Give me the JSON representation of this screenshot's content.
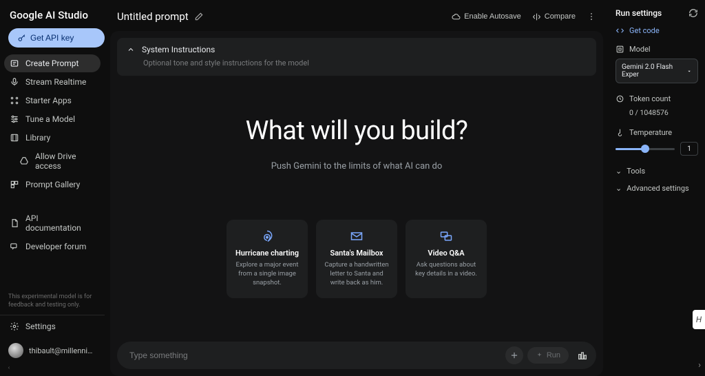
{
  "app": {
    "name": "Google AI Studio"
  },
  "sidebar": {
    "api_button": "Get API key",
    "nav": [
      {
        "label": "Create Prompt"
      },
      {
        "label": "Stream Realtime"
      },
      {
        "label": "Starter Apps"
      },
      {
        "label": "Tune a Model"
      },
      {
        "label": "Library"
      },
      {
        "label": "Allow Drive access"
      },
      {
        "label": "Prompt Gallery"
      }
    ],
    "nav2": [
      {
        "label": "API documentation"
      },
      {
        "label": "Developer forum"
      }
    ],
    "disclaimer": "This experimental model is for feedback and testing only.",
    "settings": "Settings",
    "user": "thibault@millennium-dig..."
  },
  "topbar": {
    "title": "Untitled prompt",
    "autosave": "Enable Autosave",
    "compare": "Compare"
  },
  "system_instructions": {
    "title": "System Instructions",
    "subtitle": "Optional tone and style instructions for the model"
  },
  "hero": {
    "heading": "What will you build?",
    "sub": "Push Gemini to the limits of what AI can do"
  },
  "cards": [
    {
      "title": "Hurricane charting",
      "desc": "Explore a major event from a single image snapshot."
    },
    {
      "title": "Santa's Mailbox",
      "desc": "Capture a handwritten letter to Santa and write back as him."
    },
    {
      "title": "Video Q&A",
      "desc": "Ask questions about key details in a video."
    }
  ],
  "input": {
    "placeholder": "Type something",
    "run": "Run"
  },
  "right": {
    "title": "Run settings",
    "get_code": "Get code",
    "model_label": "Model",
    "model_value": "Gemini 2.0 Flash Exper",
    "token_label": "Token count",
    "token_value": "0 / 1048576",
    "temp_label": "Temperature",
    "temp_value": "1",
    "tools": "Tools",
    "advanced": "Advanced settings"
  }
}
